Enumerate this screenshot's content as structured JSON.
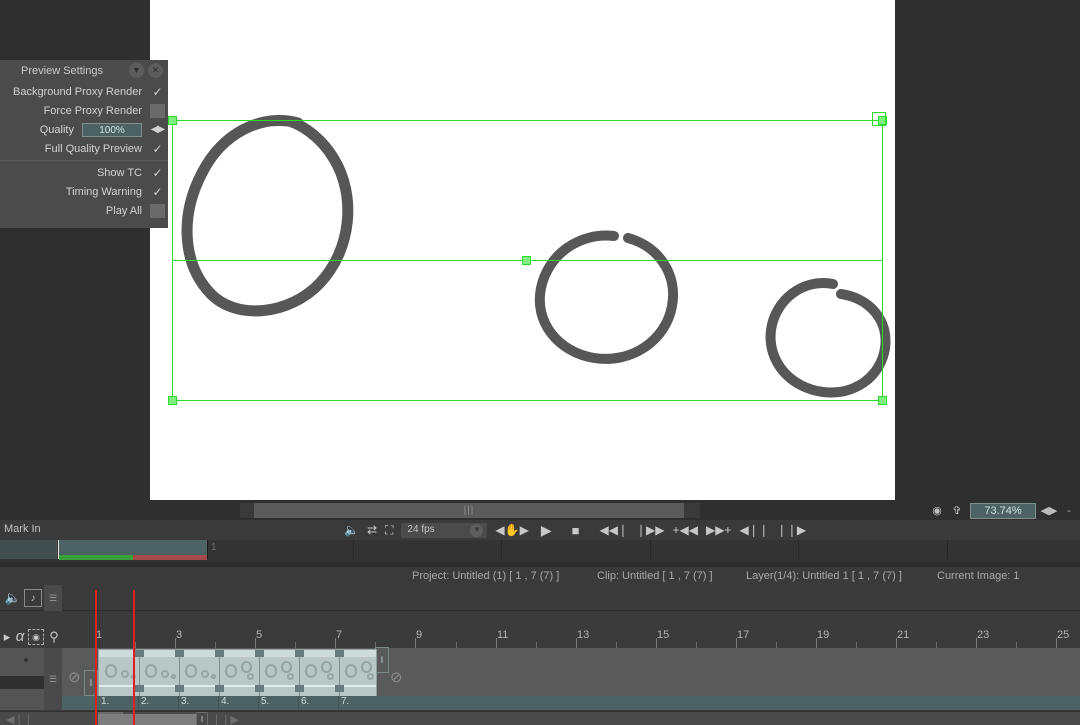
{
  "preview_settings": {
    "title": "Preview Settings",
    "collapse_icon": "chevron-down-icon",
    "close_icon": "close-icon",
    "rows": [
      {
        "label": "Background Proxy Render",
        "control": "check",
        "checked": true
      },
      {
        "label": "Force Proxy Render",
        "control": "box",
        "checked": false
      },
      {
        "label": "Quality",
        "control": "field",
        "value": "100%"
      },
      {
        "label": "Full Quality Preview",
        "control": "check",
        "checked": true
      },
      {
        "label": "Show TC",
        "control": "check",
        "checked": true
      },
      {
        "label": "Timing Warning",
        "control": "check",
        "checked": true
      },
      {
        "label": "Play All",
        "control": "box",
        "checked": false
      }
    ]
  },
  "viewer": {
    "zoom_level": "73.74%",
    "zoom_icons": [
      "fit-icon",
      "pan-icon"
    ],
    "zoom_stepper": "stepper-icon",
    "zoom_minus": "-",
    "scroll_grip": "|||"
  },
  "transport": {
    "mark_in_label": "Mark In",
    "fps_value": "24 fps",
    "buttons": [
      {
        "name": "audio-toggle-icon",
        "glyph": "◂)"
      },
      {
        "name": "loop-icon",
        "glyph": "↻"
      },
      {
        "name": "fullscreen-icon",
        "glyph": "⛶"
      },
      {
        "name": "fps-dropdown",
        "glyph": "▼"
      },
      {
        "name": "hand-scrub-icon",
        "glyph": "✋"
      },
      {
        "name": "play-button",
        "glyph": "▶"
      },
      {
        "name": "stop-button",
        "glyph": "■"
      },
      {
        "name": "go-to-start-button",
        "glyph": "❙◀◀"
      },
      {
        "name": "go-to-end-button",
        "glyph": "▶▶❙"
      },
      {
        "name": "previous-mark-button",
        "glyph": "+◀◀"
      },
      {
        "name": "next-mark-button",
        "glyph": "▶▶+"
      },
      {
        "name": "step-back-button",
        "glyph": "◀❙❙"
      },
      {
        "name": "step-forward-button",
        "glyph": "❙❙▶"
      }
    ]
  },
  "markbar": {
    "current_frame_label": "1"
  },
  "status": {
    "project": "Project: Untitled (1) [ 1 , 7  (7) ]",
    "clip": "Clip: Untitled [ 1 , 7  (7) ]",
    "layer": "Layer(1/4): Untitled 1 [ 1 , 7  (7) ]",
    "current_image": "Current Image: 1"
  },
  "timeline": {
    "top_icons": [
      {
        "name": "speaker-icon",
        "glyph": "◂)"
      },
      {
        "name": "image-note-icon",
        "glyph": "♪"
      }
    ],
    "tool_icons": [
      {
        "name": "alpha-icon",
        "glyph": "α"
      },
      {
        "name": "selection-marquee-icon",
        "glyph": "⌘"
      },
      {
        "name": "magnifier-icon",
        "glyph": "⌕"
      }
    ],
    "ruler_labels": [
      "1",
      "3",
      "5",
      "7",
      "9",
      "11",
      "13",
      "15",
      "17",
      "19",
      "21",
      "23",
      "25"
    ],
    "frame_numbers": [
      "1.",
      "2.",
      "3.",
      "4.",
      "5.",
      "6.",
      "7."
    ],
    "left_ghost_icon": "no-layer-icon",
    "right_ghost_icon": "no-layer-icon",
    "endcap_glyph": "‖"
  }
}
